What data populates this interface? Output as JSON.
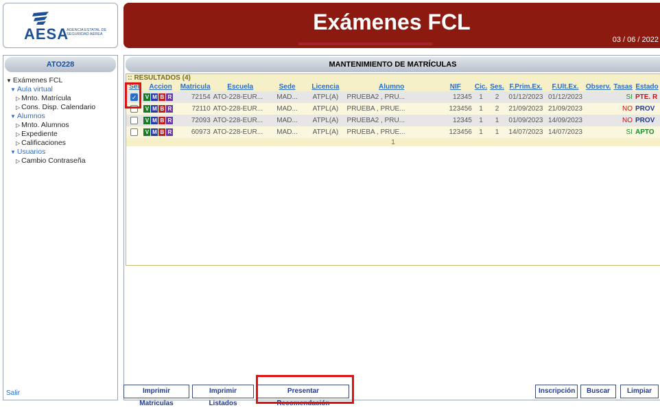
{
  "logo": {
    "brand": "AESA",
    "subtitle": "AGENCIA ESTATAL DE SEGURIDAD AÉREA"
  },
  "header": {
    "title": "Exámenes FCL",
    "date": "03 / 06 / 2022"
  },
  "sidebar": {
    "user": "ATO228",
    "items": [
      {
        "label": "Exámenes FCL"
      },
      {
        "label": "Aula virtual"
      },
      {
        "label": "Mnto. Matrícula"
      },
      {
        "label": "Cons. Disp. Calendario"
      },
      {
        "label": "Alumnos"
      },
      {
        "label": "Mnto. Alumnos"
      },
      {
        "label": "Expediente"
      },
      {
        "label": "Calificaciones"
      },
      {
        "label": "Usuarios"
      },
      {
        "label": "Cambio Contraseña"
      }
    ],
    "logout": "Salir"
  },
  "main": {
    "section_title": "MANTENIMIENTO DE MATRÍCULAS",
    "results_title": ":: RESULTADOS (4)",
    "columns": [
      "Sel",
      "Accion",
      "Matricula",
      "Escuela",
      "Sede",
      "Licencia",
      "Alumno",
      "NIF",
      "Cic.",
      "Ses.",
      "F.Prim.Ex.",
      "F.Ult.Ex.",
      "Observ.",
      "Tasas",
      "Estado"
    ],
    "action_letters": [
      "V",
      "M",
      "B",
      "R"
    ],
    "rows": [
      {
        "selected": true,
        "matricula": "72154",
        "escuela": "ATO-228-EUR...",
        "sede": "MAD...",
        "licencia": "ATPL(A)",
        "alumno": "PRUEBA2 , PRU...",
        "nif": "12345",
        "cic": "1",
        "ses": "2",
        "fprim": "01/12/2023",
        "fult": "01/12/2023",
        "observ": "",
        "tasas": "SI",
        "estado": "PTE. R"
      },
      {
        "selected": false,
        "matricula": "72110",
        "escuela": "ATO-228-EUR...",
        "sede": "MAD...",
        "licencia": "ATPL(A)",
        "alumno": "PRUEBA , PRUE...",
        "nif": "123456",
        "cic": "1",
        "ses": "2",
        "fprim": "21/09/2023",
        "fult": "21/09/2023",
        "observ": "",
        "tasas": "NO",
        "estado": "PROV"
      },
      {
        "selected": false,
        "matricula": "72093",
        "escuela": "ATO-228-EUR...",
        "sede": "MAD...",
        "licencia": "ATPL(A)",
        "alumno": "PRUEBA2 , PRU...",
        "nif": "12345",
        "cic": "1",
        "ses": "1",
        "fprim": "01/09/2023",
        "fult": "14/09/2023",
        "observ": "",
        "tasas": "NO",
        "estado": "PROV"
      },
      {
        "selected": false,
        "matricula": "60973",
        "escuela": "ATO-228-EUR...",
        "sede": "MAD...",
        "licencia": "ATPL(A)",
        "alumno": "PRUEBA , PRUE...",
        "nif": "123456",
        "cic": "1",
        "ses": "1",
        "fprim": "14/07/2023",
        "fult": "14/07/2023",
        "observ": "",
        "tasas": "SI",
        "estado": "APTO"
      }
    ],
    "page": "1"
  },
  "footer": {
    "buttons": {
      "imprimir_matriculas": "Imprimir Matriculas",
      "imprimir_listados": "Imprimir Listados",
      "presentar_recomendacion": "Presentar Recomendación",
      "inscripcion": "Inscripción",
      "buscar": "Buscar",
      "limpiar": "Limpiar"
    }
  },
  "colors": {
    "header_bg": "#8c1a10",
    "link_blue": "#2b6cc4",
    "highlight_red": "#e01010"
  }
}
